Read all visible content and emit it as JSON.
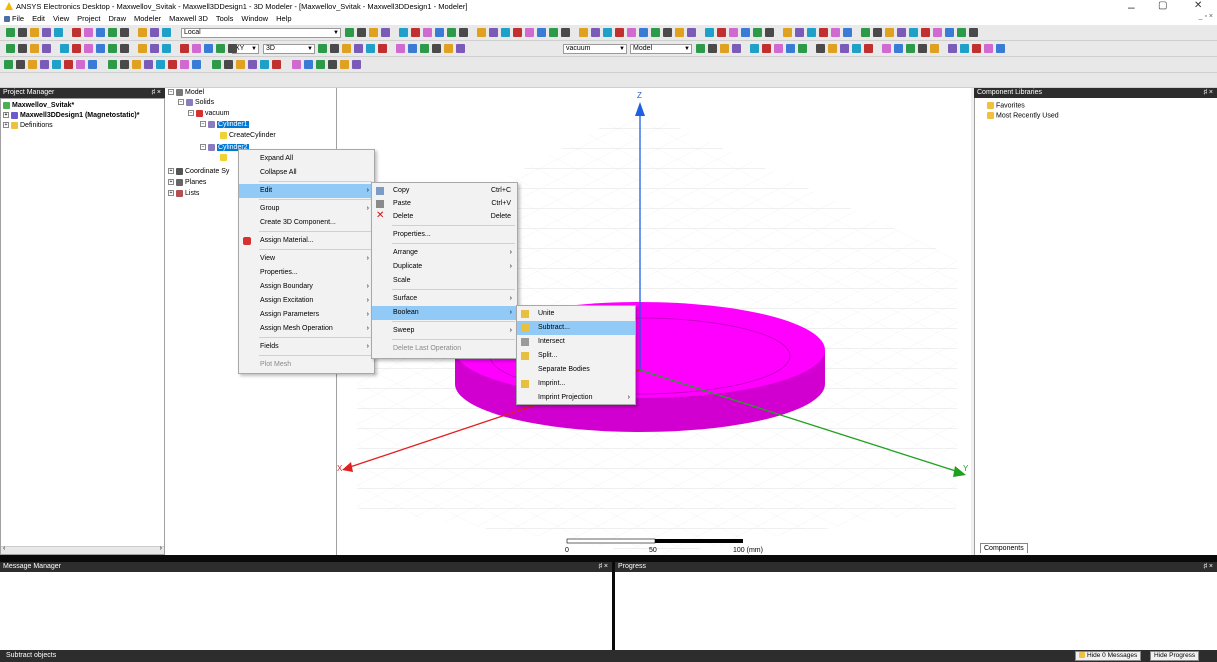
{
  "window": {
    "title": "ANSYS Electronics Desktop - Maxwellov_Svitak - Maxwell3DDesign1 - 3D Modeler - [Maxwellov_Svitak - Maxwell3DDesign1 - Modeler]",
    "minimize": "–",
    "maximize": "▢",
    "close": "✕"
  },
  "menubar": {
    "items": [
      "File",
      "Edit",
      "View",
      "Project",
      "Draw",
      "Modeler",
      "Maxwell 3D",
      "Tools",
      "Window",
      "Help"
    ],
    "mdi_controls": "_ ▫ ×"
  },
  "toolbar": {
    "coord_system": "Local",
    "plane": "XY",
    "dimension": "3D",
    "material": "vacuum",
    "view_mode": "Model"
  },
  "project_manager": {
    "header": "Project Manager",
    "pin": "♯ ×",
    "project": "Maxwellov_Svitak*",
    "design": "Maxwell3DDesign1 (Magnetostatic)*",
    "definitions": "Definitions"
  },
  "model_tree": {
    "model": "Model",
    "solids": "Solids",
    "vacuum": "vacuum",
    "cylinder1": "Cylinder1",
    "create_cylinder": "CreateCylinder",
    "cylinder2": "Cylinder2",
    "coordinate_systems": "Coordinate Sy",
    "planes": "Planes",
    "lists": "Lists"
  },
  "viewport": {
    "axis_z": "Z",
    "axis_x": "X",
    "axis_y": "Y",
    "scale_0": "0",
    "scale_50": "50",
    "scale_100": "100 (mm)"
  },
  "component_libraries": {
    "header": "Component Libraries",
    "pin": "♯ ×",
    "favorites": "Favorites",
    "recent": "Most Recently Used",
    "tab": "Components"
  },
  "context_menu": {
    "items": [
      {
        "label": "Expand All"
      },
      {
        "label": "Collapse All"
      },
      {
        "label": "Edit",
        "sub": "›"
      },
      {
        "label": "Group",
        "sub": "›"
      },
      {
        "label": "Create 3D Component..."
      },
      {
        "label": "Assign Material..."
      },
      {
        "label": "View",
        "sub": "›"
      },
      {
        "label": "Properties..."
      },
      {
        "label": "Assign Boundary",
        "sub": "›"
      },
      {
        "label": "Assign Excitation",
        "sub": "›"
      },
      {
        "label": "Assign Parameters",
        "sub": "›"
      },
      {
        "label": "Assign Mesh Operation",
        "sub": "›"
      },
      {
        "label": "Fields",
        "sub": "›"
      },
      {
        "label": "Plot Mesh"
      }
    ]
  },
  "edit_menu": {
    "items": [
      {
        "label": "Copy",
        "shortcut": "Ctrl+C"
      },
      {
        "label": "Paste",
        "shortcut": "Ctrl+V"
      },
      {
        "label": "Delete",
        "shortcut": "Delete"
      },
      {
        "label": "Properties..."
      },
      {
        "label": "Arrange",
        "sub": "›"
      },
      {
        "label": "Duplicate",
        "sub": "›"
      },
      {
        "label": "Scale"
      },
      {
        "label": "Surface",
        "sub": "›"
      },
      {
        "label": "Boolean",
        "sub": "›"
      },
      {
        "label": "Sweep",
        "sub": "›"
      },
      {
        "label": "Delete Last Operation"
      }
    ]
  },
  "boolean_menu": {
    "items": [
      {
        "label": "Unite"
      },
      {
        "label": "Subtract..."
      },
      {
        "label": "Intersect"
      },
      {
        "label": "Split..."
      },
      {
        "label": "Separate Bodies"
      },
      {
        "label": "Imprint..."
      },
      {
        "label": "Imprint Projection",
        "sub": "›"
      }
    ]
  },
  "message_manager": {
    "header": "Message Manager",
    "pin": "♯ ×"
  },
  "progress": {
    "header": "Progress",
    "pin": "♯ ×"
  },
  "status": {
    "text": "Subtract objects",
    "hide_messages": "Hide 0 Messages",
    "hide_progress": "Hide Progress"
  },
  "colors": {
    "cylinder": "#ff00ff",
    "selection": "#0078d7",
    "menu_highlight": "#91c9f7",
    "axis_x": "#e02020",
    "axis_y": "#20a020",
    "axis_z": "#2060e0"
  }
}
